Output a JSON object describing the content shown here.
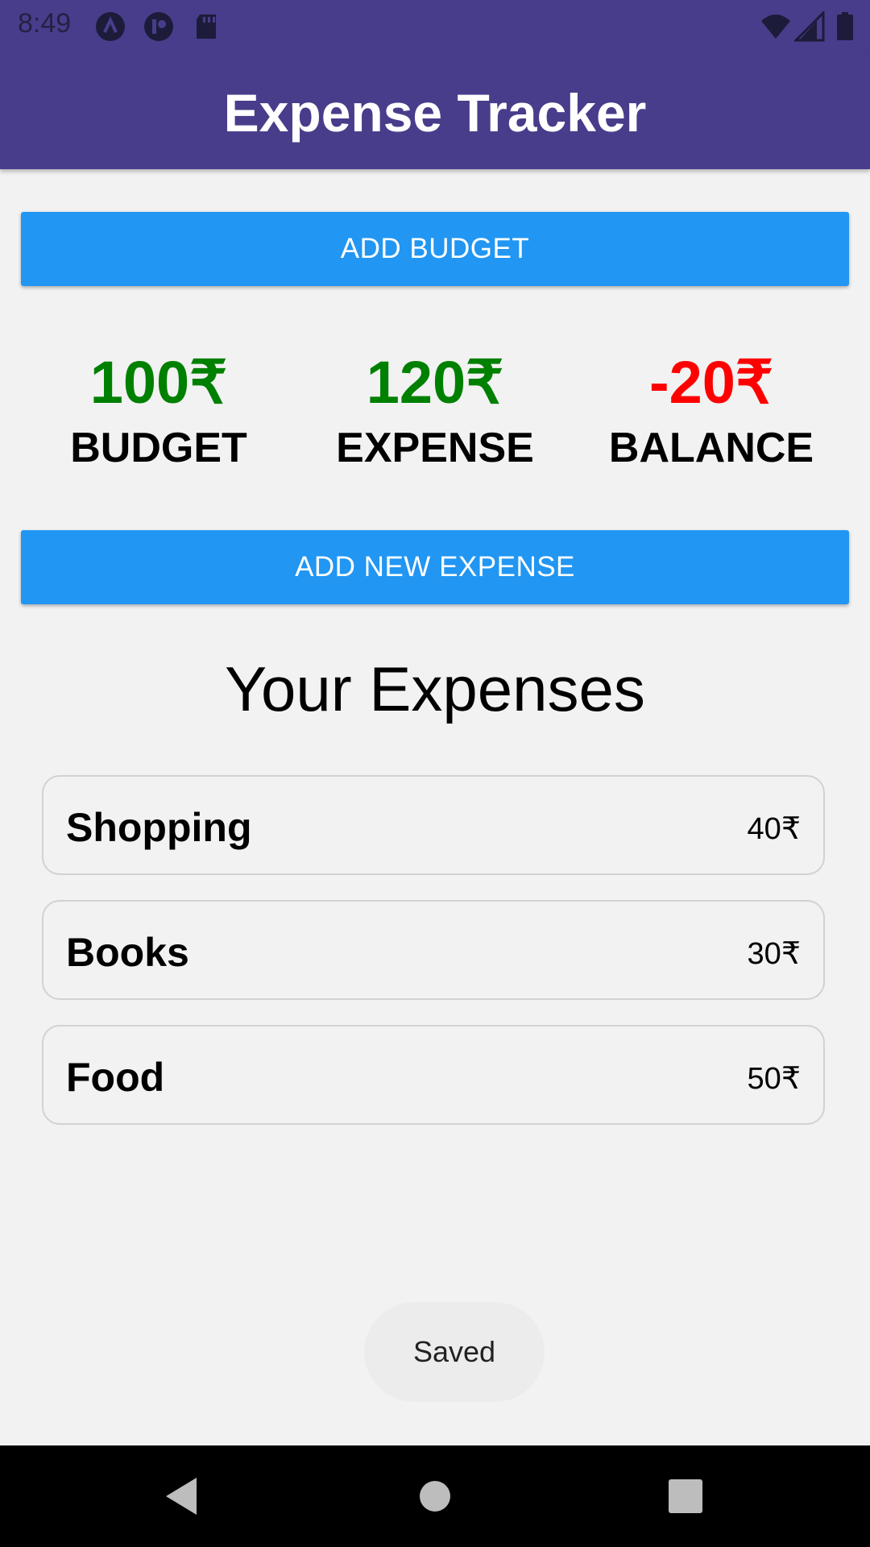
{
  "status_bar": {
    "time": "8:49",
    "left_icons": [
      "app-icon-a",
      "app-icon-p",
      "sd-card-icon"
    ],
    "right_icons": [
      "wifi-icon",
      "signal-icon",
      "battery-icon"
    ]
  },
  "app_bar": {
    "title": "Expense Tracker",
    "color": "#483d8b"
  },
  "buttons": {
    "add_budget": "ADD BUDGET",
    "add_expense": "ADD NEW EXPENSE",
    "color": "#2196f3"
  },
  "summary": [
    {
      "value": "100₹",
      "label": "BUDGET",
      "color": "#008000"
    },
    {
      "value": "120₹",
      "label": "EXPENSE",
      "color": "#008000"
    },
    {
      "value": "-20₹",
      "label": "BALANCE",
      "color": "#ff0000"
    }
  ],
  "expenses_title": "Your Expenses",
  "expenses": [
    {
      "name": "Shopping",
      "amount": "40₹"
    },
    {
      "name": "Books",
      "amount": "30₹"
    },
    {
      "name": "Food",
      "amount": "50₹"
    }
  ],
  "toast": "Saved",
  "nav_bar": {
    "buttons": [
      "back-icon",
      "home-icon",
      "recents-icon"
    ]
  }
}
